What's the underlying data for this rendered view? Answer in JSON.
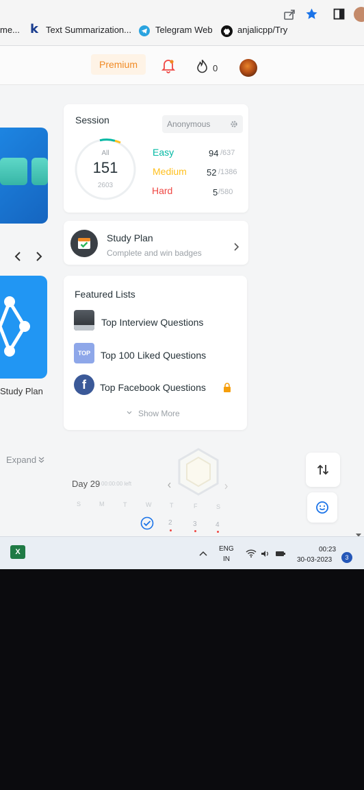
{
  "bookmarks": [
    {
      "label": "me..."
    },
    {
      "label": "Text Summarization..."
    },
    {
      "label": "Telegram Web"
    },
    {
      "label": "anjalicpp/Try"
    }
  ],
  "nav": {
    "premium_label": "Premium",
    "streak_count": "0"
  },
  "left_panel": {
    "study_plan_label": "Study Plan",
    "expand_label": "Expand"
  },
  "session": {
    "title": "Session",
    "selector_value": "Anonymous",
    "ring": {
      "label": "All",
      "solved": "151",
      "total": "2603"
    },
    "levels": [
      {
        "name": "Easy",
        "solved": "94",
        "total": "/637",
        "color": "#00b8a3"
      },
      {
        "name": "Medium",
        "solved": "52",
        "total": "/1386",
        "color": "#ffc01e"
      },
      {
        "name": "Hard",
        "solved": "5",
        "total": "/580",
        "color": "#ef4743"
      }
    ]
  },
  "study_plan": {
    "title": "Study Plan",
    "subtitle": "Complete and win badges"
  },
  "featured": {
    "title": "Featured Lists",
    "items": [
      {
        "label": "Top Interview Questions",
        "icon_text": ""
      },
      {
        "label": "Top 100 Liked Questions",
        "icon_text": "TOP"
      },
      {
        "label": "Top Facebook Questions",
        "icon_text": "f"
      }
    ],
    "show_more": "Show More"
  },
  "calendar": {
    "day_label": "Day 29",
    "day_sub": "00:00:00 left",
    "weekdays": [
      "S",
      "M",
      "T",
      "W",
      "T",
      "F",
      "S"
    ],
    "dates": [
      "2",
      "3",
      "4"
    ]
  },
  "taskbar": {
    "lang_top": "ENG",
    "lang_bottom": "IN",
    "time": "00:23",
    "date": "30-03-2023",
    "notifications": "3"
  },
  "colors": {
    "accent_orange": "#f08a24",
    "easy": "#00b8a3",
    "medium": "#ffc01e",
    "hard": "#ef4743",
    "blue_card": "#1e88e5"
  }
}
